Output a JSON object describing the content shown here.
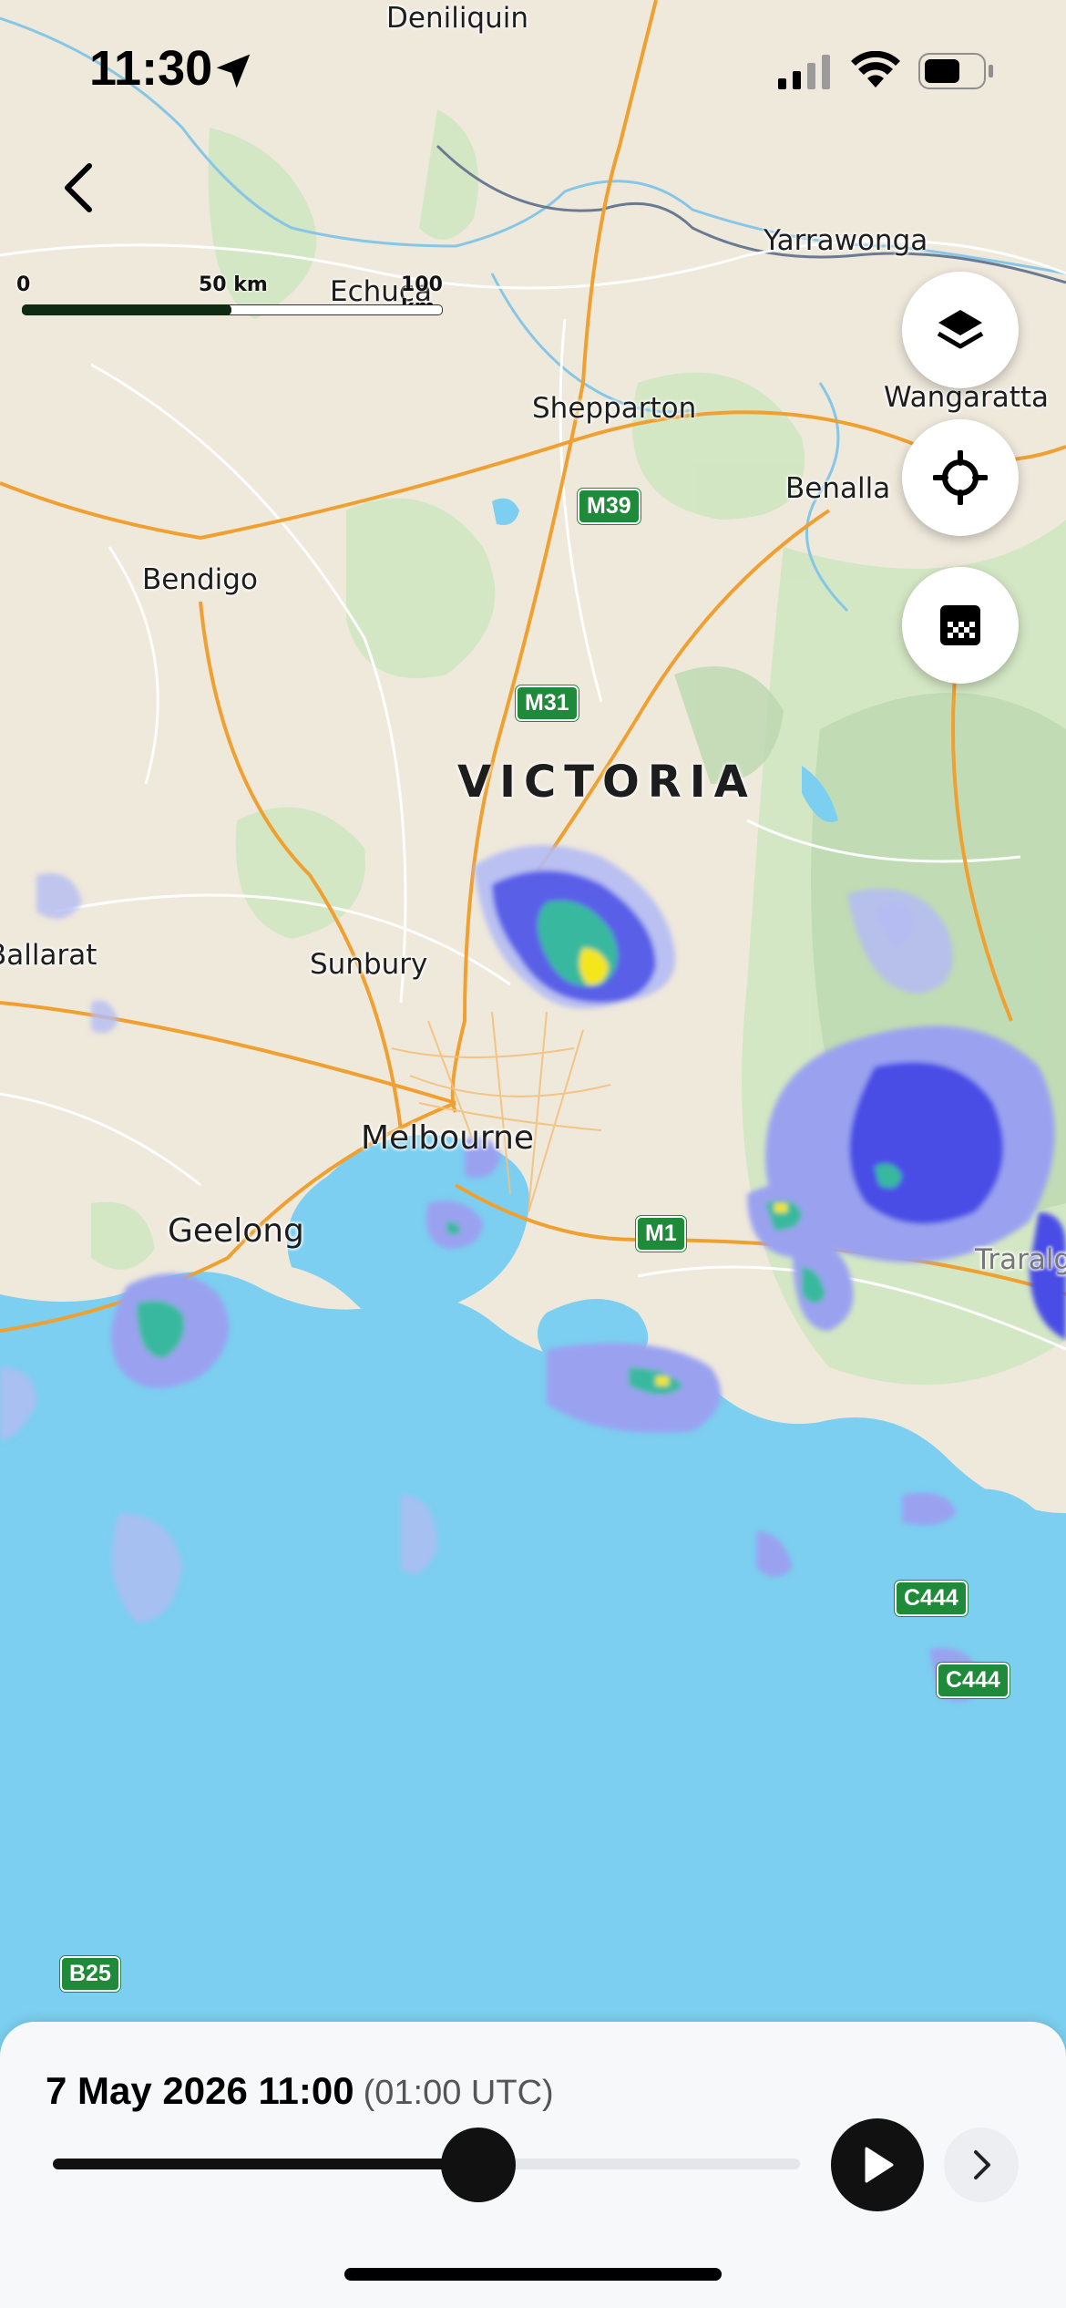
{
  "status_bar": {
    "time": "11:30",
    "icons": [
      "location-arrow-icon",
      "signal-icon",
      "wifi-icon",
      "battery-icon"
    ]
  },
  "navigation": {
    "back_icon": "chevron-left-icon"
  },
  "scale_bar": {
    "labels": [
      "0",
      "50 km",
      "100 km"
    ]
  },
  "map": {
    "region_label": "VICTORIA",
    "places": [
      "Deniliquin",
      "Yarrawonga",
      "Echuca",
      "Wangaratta",
      "Shepparton",
      "Benalla",
      "Bendigo",
      "Ballarat",
      "Sunbury",
      "Melbourne",
      "Geelong",
      "Traralgon"
    ],
    "road_shields": [
      "M39",
      "M31",
      "M1",
      "C444",
      "C444",
      "B25"
    ],
    "colors": {
      "land": "#efe9dc",
      "water": "#7ccff0",
      "motorway": "#f0a030",
      "radar_light": "#9aa4ee",
      "radar_medium": "#4a4ee6",
      "radar_heavy": "#2ec0a0",
      "radar_intense": "#f5e61a"
    }
  },
  "map_controls": [
    {
      "name": "layers-button",
      "icon": "layers-icon"
    },
    {
      "name": "my-location-button",
      "icon": "crosshair-icon"
    },
    {
      "name": "legend-button",
      "icon": "color-scale-icon"
    }
  ],
  "timeline": {
    "date_time": "7 May 2026 11:00",
    "utc": "(01:00 UTC)",
    "progress": 0.57,
    "play_icon": "play-icon",
    "next_icon": "chevron-right-icon"
  }
}
